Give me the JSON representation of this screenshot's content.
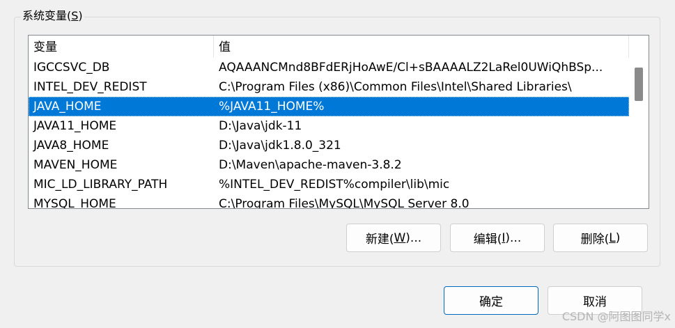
{
  "group": {
    "title_prefix": "系统变量(",
    "title_key": "S",
    "title_suffix": ")"
  },
  "listview": {
    "columns": [
      "变量",
      "值"
    ],
    "rows": [
      {
        "name": "IGCCSVC_DB",
        "value": "AQAAANCMnd8BFdERjHoAwE/Cl+sBAAAALZ2LaRel0UWiQhBSp..."
      },
      {
        "name": "INTEL_DEV_REDIST",
        "value": "C:\\Program Files (x86)\\Common Files\\Intel\\Shared Libraries\\"
      },
      {
        "name": "JAVA_HOME",
        "value": "%JAVA11_HOME%"
      },
      {
        "name": "JAVA11_HOME",
        "value": "D:\\Java\\jdk-11"
      },
      {
        "name": "JAVA8_HOME",
        "value": "D:\\Java\\jdk1.8.0_321"
      },
      {
        "name": "MAVEN_HOME",
        "value": "D:\\Maven\\apache-maven-3.8.2"
      },
      {
        "name": "MIC_LD_LIBRARY_PATH",
        "value": "%INTEL_DEV_REDIST%compiler\\lib\\mic"
      },
      {
        "name": "MYSQL_HOME",
        "value": "C:\\Program Files\\MySQL\\MySQL Server 8.0"
      }
    ],
    "selected_index": 2
  },
  "buttons": {
    "new_prefix": "新建(",
    "new_key": "W",
    "new_suffix": ")...",
    "edit_prefix": "编辑(",
    "edit_key": "I",
    "edit_suffix": ")...",
    "delete_prefix": "删除(",
    "delete_key": "L",
    "delete_suffix": ")",
    "ok": "确定",
    "cancel": "取消"
  },
  "watermark": "CSDN @阿图图同学x",
  "colors": {
    "selection": "#0078d7",
    "primary_border": "#0067c0"
  }
}
